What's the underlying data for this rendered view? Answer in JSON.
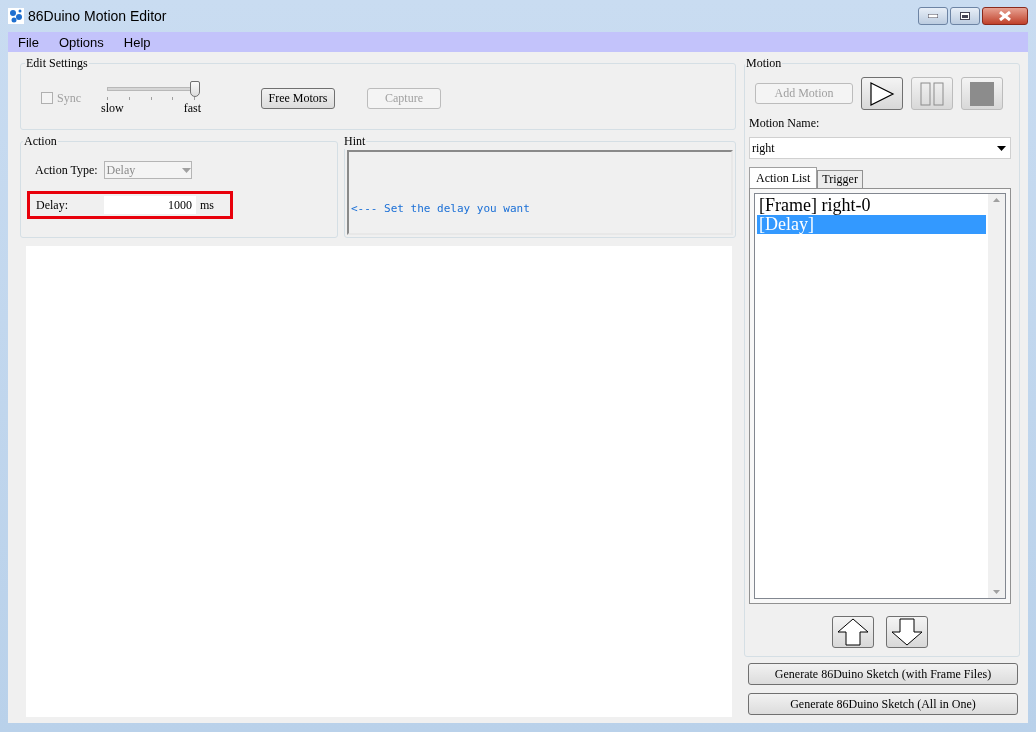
{
  "window": {
    "title": "86Duino Motion Editor"
  },
  "menu": [
    "File",
    "Options",
    "Help"
  ],
  "edit_settings": {
    "title": "Edit Settings",
    "sync": {
      "label": "Sync",
      "checked": false,
      "disabled": true
    },
    "speed": {
      "level": 1,
      "min_label": "slow",
      "max_label": "fast"
    },
    "buttons": [
      {
        "label": "Free Motors",
        "disabled": false
      },
      {
        "label": "Capture",
        "disabled": true
      }
    ]
  },
  "action": {
    "title": "Action",
    "type_label": "Action Type:",
    "type_value": "Delay",
    "delay_label": "Delay:",
    "delay_value": "1000",
    "unit": "ms",
    "highlighted": true
  },
  "hint": {
    "title": "Hint",
    "text": "<--- Set the delay you want"
  },
  "motion": {
    "title": "Motion",
    "add_button": {
      "label": "Add Motion",
      "disabled": true
    },
    "transport": [
      {
        "kind": "play",
        "disabled": false
      },
      {
        "kind": "pause",
        "disabled": true
      },
      {
        "kind": "stop",
        "disabled": true
      }
    ],
    "name_label": "Motion Name:",
    "name_value": "right",
    "tabs": [
      {
        "label": "Action List",
        "selected": true
      },
      {
        "label": "Trigger",
        "selected": false
      }
    ],
    "items": [
      {
        "text": "[Frame] right-0",
        "selected": false
      },
      {
        "text": "[Delay]",
        "selected": true
      }
    ],
    "move_buttons": [
      {
        "kind": "up"
      },
      {
        "kind": "down"
      }
    ]
  },
  "generate_buttons": [
    "Generate 86Duino Sketch (with Frame Files)",
    "Generate 86Duino Sketch (All in One)"
  ]
}
